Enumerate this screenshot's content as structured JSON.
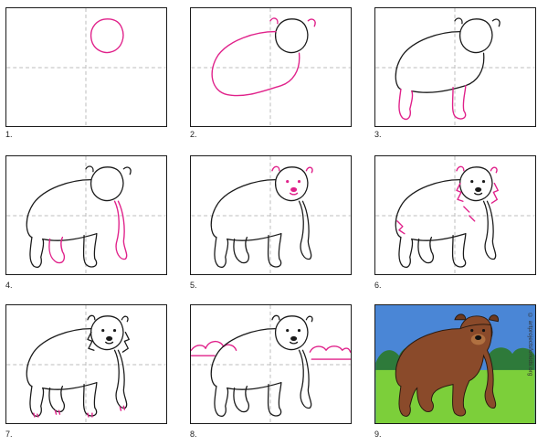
{
  "steps": [
    {
      "label": "1."
    },
    {
      "label": "2."
    },
    {
      "label": "3."
    },
    {
      "label": "4."
    },
    {
      "label": "5."
    },
    {
      "label": "6."
    },
    {
      "label": "7."
    },
    {
      "label": "8."
    },
    {
      "label": "9."
    }
  ],
  "watermark": "© artprojectsforkids.org",
  "colors": {
    "outline": "#1a1a1a",
    "new_step_lines": "#e0218a",
    "guide_lines": "#bdbdbd",
    "sky": "#4a86d6",
    "trees": "#2e7a3a",
    "grass": "#7ccf3a",
    "bear_fur": "#8a4a2a"
  }
}
